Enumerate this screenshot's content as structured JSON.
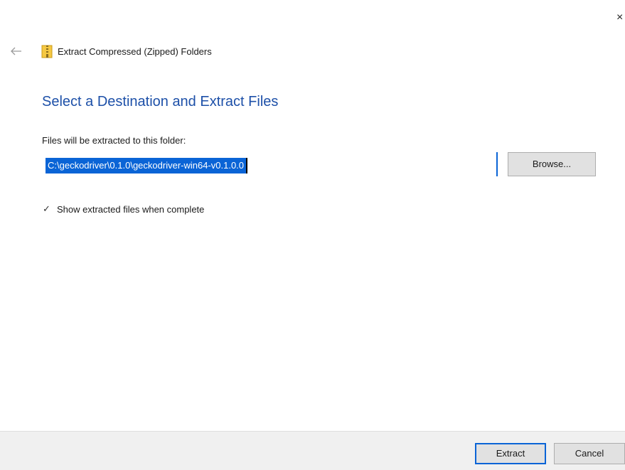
{
  "window": {
    "close_glyph": "×"
  },
  "nav": {
    "back_icon": "back-arrow-icon",
    "folder_icon": "zip-folder-icon",
    "title": "Extract Compressed (Zipped) Folders"
  },
  "main": {
    "heading": "Select a Destination and Extract Files",
    "destination_label": "Files will be extracted to this folder:",
    "destination_path": "C:\\geckodriver\\0.1.0\\geckodriver-win64-v0.1.0.0",
    "browse_label": "Browse...",
    "show_files_label": "Show extracted files when complete",
    "show_files_checked": true
  },
  "footer": {
    "extract_label": "Extract",
    "cancel_label": "Cancel"
  },
  "colors": {
    "heading": "#1d50a8",
    "selection": "#0a64d6",
    "footer_bg": "#f0f0f0",
    "button_bg": "#e1e1e1"
  }
}
